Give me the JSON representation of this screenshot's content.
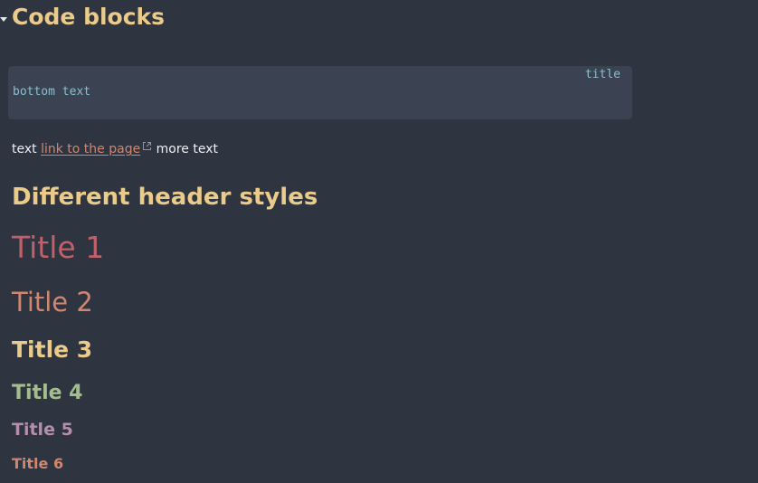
{
  "section_code": {
    "heading": "Code blocks"
  },
  "code_block": {
    "title": "title",
    "line": "bottom text"
  },
  "paragraph": {
    "text_before": "text ",
    "link_text": "link to the page",
    "text_after": " more text"
  },
  "section_headers": {
    "heading": "Different header styles",
    "titles": [
      "Title 1",
      "Title 2",
      "Title 3",
      "Title 4",
      "Title 5",
      "Title 6"
    ]
  },
  "icons": {
    "collapse": "caret-down-icon",
    "external_link": "external-link-icon"
  },
  "colors": {
    "background": "#2e3440",
    "code_background": "#3b4252",
    "code_text": "#88c0d0",
    "heading_yellow": "#ebcb8b",
    "title1": "#bf616a",
    "title2": "#d08770",
    "title4": "#a3be8c",
    "title5": "#b48ead",
    "link": "#d08770"
  }
}
